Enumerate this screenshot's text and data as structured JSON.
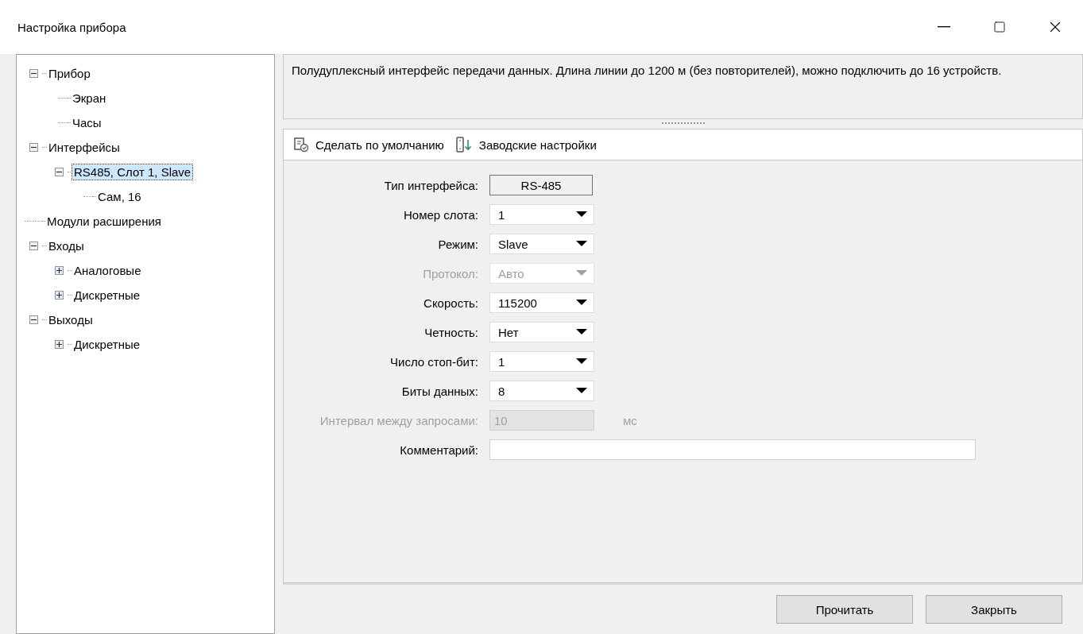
{
  "window": {
    "title": "Настройка прибора"
  },
  "tree": [
    {
      "label": "Прибор",
      "expanded": true,
      "selected": false,
      "children": [
        {
          "label": "Экран",
          "selected": false
        },
        {
          "label": "Часы",
          "selected": false
        }
      ]
    },
    {
      "label": "Интерфейсы",
      "expanded": true,
      "selected": false,
      "children": [
        {
          "label": "RS485, Слот 1, Slave",
          "expanded": true,
          "selected": true,
          "children": [
            {
              "label": "Сам, 16",
              "selected": false
            }
          ]
        }
      ]
    },
    {
      "label": "Модули расширения",
      "selected": false
    },
    {
      "label": "Входы",
      "expanded": true,
      "selected": false,
      "children": [
        {
          "label": "Аналоговые",
          "expanded": false,
          "selected": false
        },
        {
          "label": "Дискретные",
          "expanded": false,
          "selected": false
        }
      ]
    },
    {
      "label": "Выходы",
      "expanded": true,
      "selected": false,
      "children": [
        {
          "label": "Дискретные",
          "expanded": false,
          "selected": false
        }
      ]
    }
  ],
  "description": "Полудуплексный интерфейс передачи данных. Длина линии до 1200 м (без повторителей), можно подключить до 16 устройств.",
  "toolbar": [
    {
      "kind": "default",
      "label": "Сделать по умолчанию"
    },
    {
      "kind": "factory",
      "label": "Заводские настройки"
    }
  ],
  "fields": [
    {
      "kind": "readonly",
      "label": "Тип интерфейса:",
      "value": "RS-485"
    },
    {
      "kind": "dropdown",
      "label": "Номер слота:",
      "value": "1",
      "disabled": false
    },
    {
      "kind": "dropdown",
      "label": "Режим:",
      "value": "Slave",
      "disabled": false
    },
    {
      "kind": "dropdown",
      "label": "Протокол:",
      "value": "Авто",
      "disabled": true
    },
    {
      "kind": "dropdown",
      "label": "Скорость:",
      "value": "115200",
      "disabled": false
    },
    {
      "kind": "dropdown",
      "label": "Четность:",
      "value": "Нет",
      "disabled": false
    },
    {
      "kind": "dropdown",
      "label": "Число стоп-бит:",
      "value": "1",
      "disabled": false
    },
    {
      "kind": "dropdown",
      "label": "Биты данных:",
      "value": "8",
      "disabled": false
    },
    {
      "kind": "text",
      "label": "Интервал между запросами:",
      "value": "10",
      "unit": "мс",
      "disabled": true
    },
    {
      "kind": "wide",
      "label": "Комментарий:",
      "disabled": false
    }
  ],
  "buttons": [
    "Прочитать",
    "Закрыть"
  ]
}
